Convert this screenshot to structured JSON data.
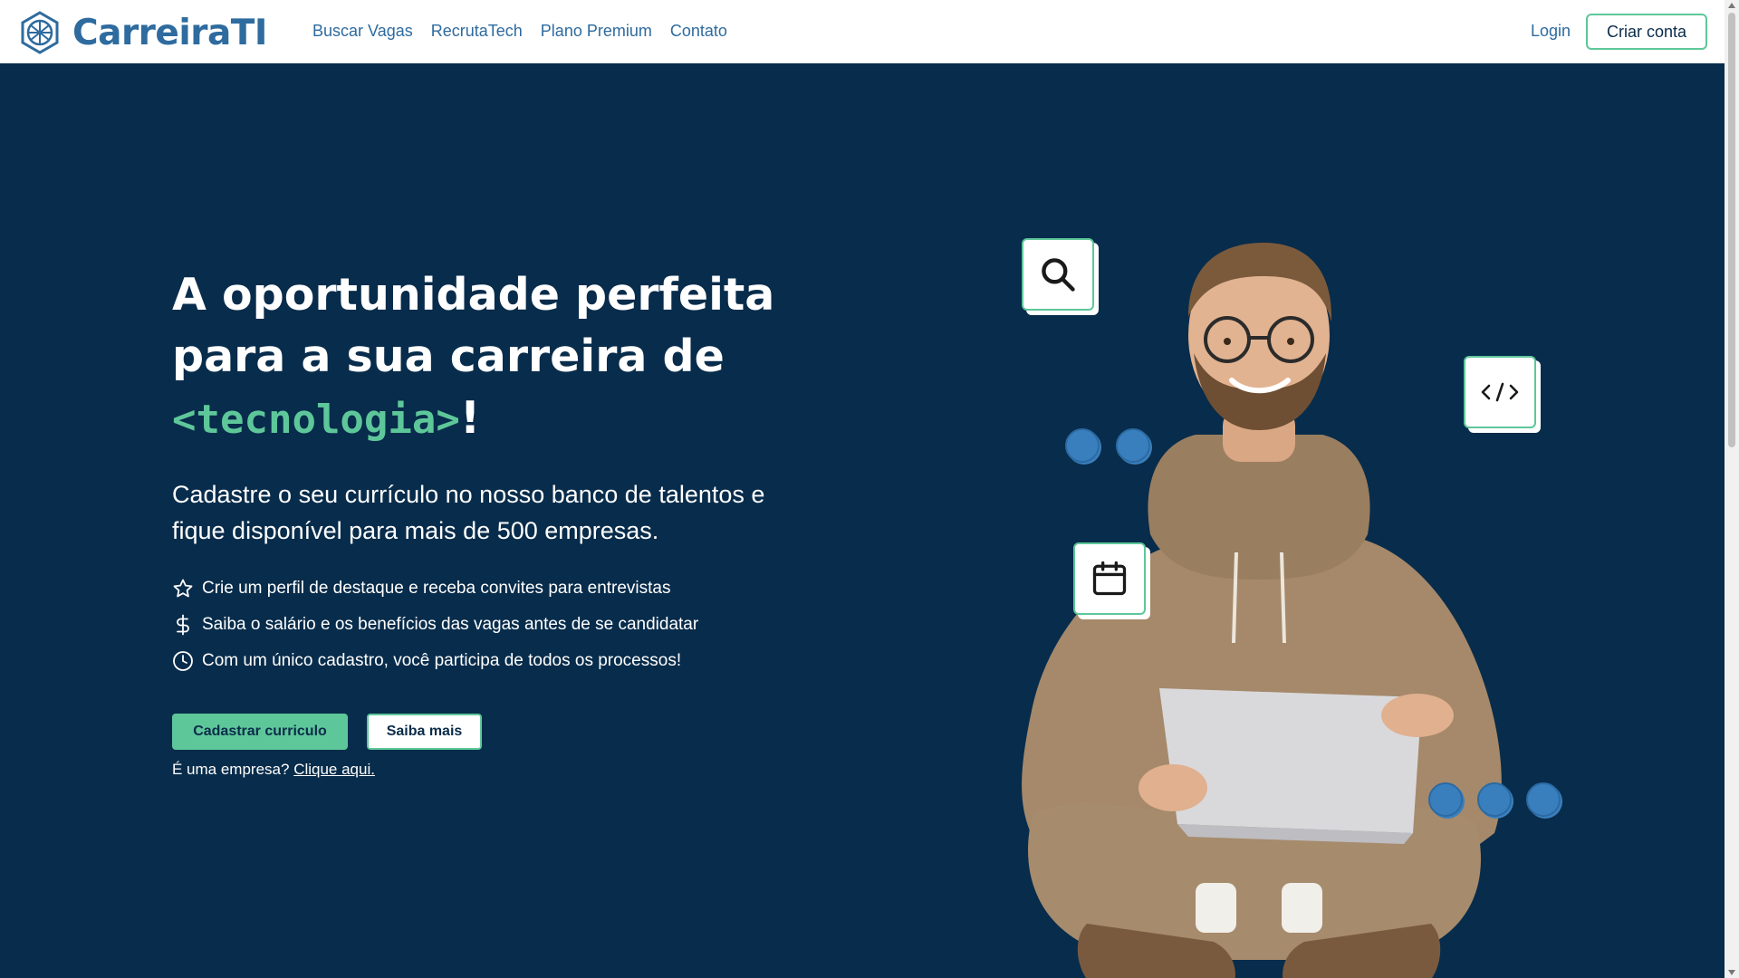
{
  "brand": {
    "name": "CarreiraTI",
    "icon": "hex-network-logo-icon"
  },
  "nav": {
    "links": [
      "Buscar Vagas",
      "RecrutaTech",
      "Plano Premium",
      "Contato"
    ],
    "login": "Login",
    "signup": "Criar conta"
  },
  "hero": {
    "headline_line1": "A oportunidade perfeita",
    "headline_line2": "para a sua carreira de",
    "headline_accent": "<tecnologia>",
    "headline_end": "!",
    "subtitle": "Cadastre o seu currículo no nosso banco de talentos e fique disponível para mais de 500 empresas.",
    "features": [
      {
        "icon": "star-icon",
        "text": "Crie um perfil de destaque e receba convites para entrevistas"
      },
      {
        "icon": "dollar-icon",
        "text": "Saiba o salário e os benefícios das vagas antes de se candidatar"
      },
      {
        "icon": "clock-icon",
        "text": "Com um único cadastro, você participa de todos os processos!"
      }
    ],
    "primary_button": "Cadastrar curriculo",
    "secondary_button": "Saiba mais",
    "company_prefix": "É uma empresa?",
    "company_link": "Clique aqui."
  },
  "illustration": {
    "cards": [
      "search-icon",
      "code-icon",
      "calendar-icon"
    ]
  },
  "colors": {
    "hero_bg": "#082c4b",
    "accent_green": "#5ec79a",
    "brand_blue": "#2e6b9e",
    "dot_blue": "#3a7fbd"
  }
}
